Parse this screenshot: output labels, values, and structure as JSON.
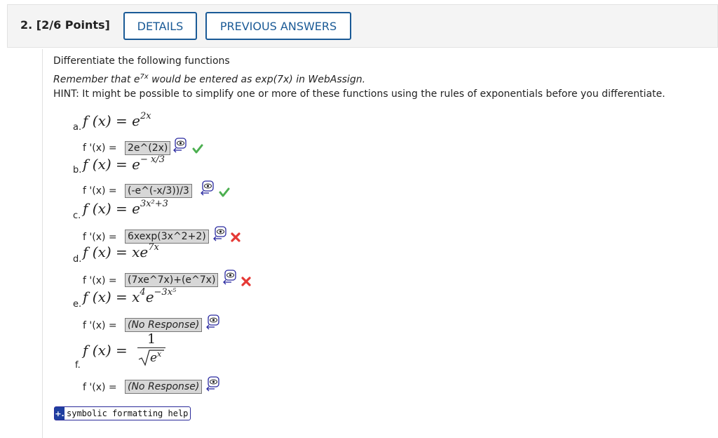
{
  "question": {
    "number_label": "2. [2/6 Points]",
    "details_label": "DETAILS",
    "previous_answers_label": "PREVIOUS ANSWERS"
  },
  "instructions": {
    "line1": "Differentiate the following functions",
    "line2_prefix": "Remember that e",
    "line2_sup": "7x",
    "line2_suffix": " would be entered as exp(7x) in WebAssign.",
    "hint": "HINT: It might be possible to simplify one or more of these functions using the rules of exponentials before you differentiate."
  },
  "parts": [
    {
      "letter": "a.",
      "func_lhs": "f (x) = e",
      "exp": "2x",
      "answer": "2e^(2x)",
      "status": "correct"
    },
    {
      "letter": "b.",
      "func_lhs": "f (x) = e",
      "exp": "− x/3",
      "answer": "(-e^(-x/3))/3",
      "status": "correct"
    },
    {
      "letter": "c.",
      "func_lhs": "f (x) = e",
      "exp": "3x²+3",
      "answer": "6xexp(3x^2+2)",
      "status": "incorrect"
    },
    {
      "letter": "d.",
      "func_lhs": "f (x) = xe",
      "exp": "7x",
      "answer": "(7xe^7x)+(e^7x)",
      "status": "incorrect"
    },
    {
      "letter": "e.",
      "func_lhs": "f (x) = x",
      "exp4": "4",
      "exp": "−3x⁵",
      "answer": "(No Response)",
      "status": "none"
    },
    {
      "letter": "f.",
      "func_lhs": "f (x) =",
      "numerator": "1",
      "denominator": "e",
      "den_exp": "x",
      "answer": "(No Response)",
      "status": "none"
    }
  ],
  "derivative_label": "f '(x) =",
  "help": {
    "icon": "+.",
    "label": "symbolic formatting help"
  },
  "colors": {
    "accent": "#1a5a96",
    "correct": "#4caf50",
    "incorrect": "#e53935"
  }
}
